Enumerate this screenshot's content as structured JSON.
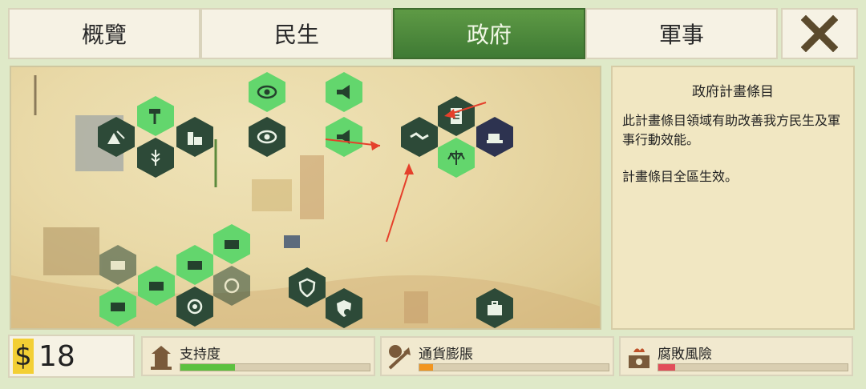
{
  "tabs": [
    {
      "label": "概覽",
      "active": false
    },
    {
      "label": "民生",
      "active": false
    },
    {
      "label": "政府",
      "active": true
    },
    {
      "label": "軍事",
      "active": false
    }
  ],
  "close_icon": "x-close-icon",
  "info_panel": {
    "title": "政府計畫條目",
    "paragraph1": "此計畫條目領域有助改善我方民生及軍事行動效能。",
    "paragraph2": "計畫條目全區生效。"
  },
  "money": {
    "symbol": "$",
    "value": "18"
  },
  "stats": [
    {
      "label": "支持度",
      "icon": "support-building-icon",
      "level_percent": 29,
      "color": "#5cc13f"
    },
    {
      "label": "通貨膨脹",
      "icon": "inflation-coin-icon",
      "level_percent": 7,
      "color": "#f2951f"
    },
    {
      "label": "腐敗風險",
      "icon": "corruption-money-icon",
      "level_percent": 9,
      "color": "#e24d5a"
    }
  ],
  "colors": {
    "active_tab": "#4c8a3a",
    "hex_bright": "#63d66d",
    "hex_dark": "#2d4a38",
    "hex_navy": "#2d3350",
    "arrow": "#e5402b"
  }
}
